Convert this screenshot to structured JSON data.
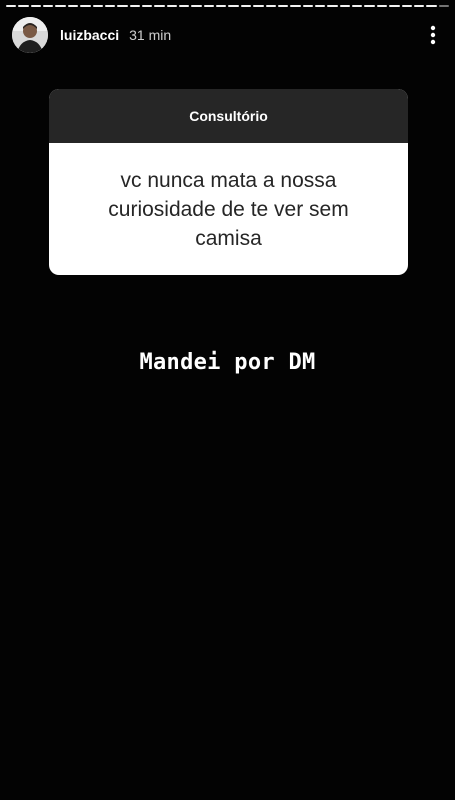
{
  "story": {
    "progress": {
      "segments": 36,
      "completed": 35
    },
    "header": {
      "username": "luizbacci",
      "timestamp": "31 min",
      "avatar_icon": "profile-photo-icon",
      "more_icon": "vertical-ellipsis-icon"
    },
    "question_card": {
      "title": "Consultório",
      "question": "vc nunca mata a nossa curiosidade de te ver sem camisa"
    },
    "reply_text": "Mandei por DM"
  },
  "colors": {
    "background": "#030303",
    "card_header": "#262626",
    "card_body": "#ffffff",
    "card_text": "#262626",
    "text_light": "#ffffff"
  }
}
